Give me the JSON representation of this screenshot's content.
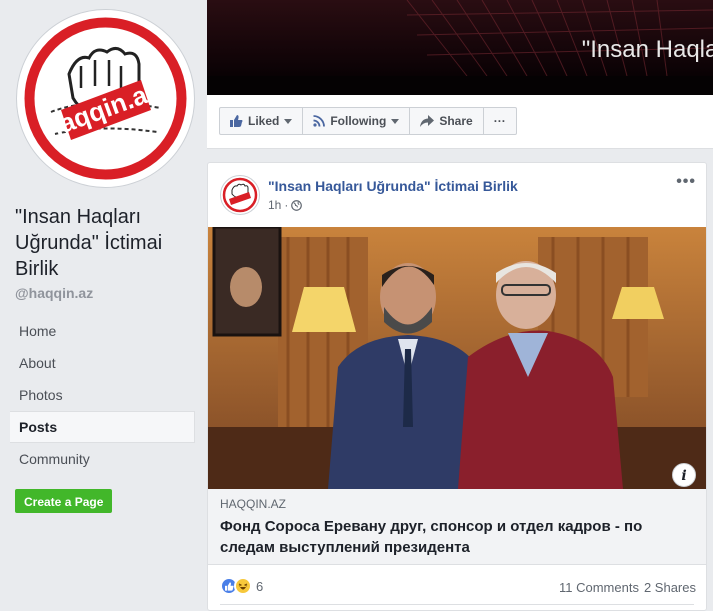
{
  "page": {
    "name": "\"Insan Haqları Uğrunda\" İctimai Birlik",
    "handle": "@haqqin.az",
    "logo_text": "haqqin.az"
  },
  "nav": {
    "items": [
      {
        "label": "Home",
        "active": false
      },
      {
        "label": "About",
        "active": false
      },
      {
        "label": "Photos",
        "active": false
      },
      {
        "label": "Posts",
        "active": true
      },
      {
        "label": "Community",
        "active": false
      }
    ],
    "create_page": "Create a Page"
  },
  "cover": {
    "title": "\"Insan Haqları"
  },
  "actions": {
    "liked": "Liked",
    "following": "Following",
    "share": "Share",
    "more": "···"
  },
  "post": {
    "author": "\"Insan Haqları Uğrunda\" İctimai Birlik",
    "time": "1h",
    "more": "•••",
    "link": {
      "domain": "HAQQIN.AZ",
      "title": "Фонд Сороса Еревану друг, спонсор и отдел кадров - по следам выступлений президента"
    },
    "reactions": {
      "count": "6",
      "types": [
        "like-icon",
        "haha-icon"
      ]
    },
    "comments": "11 Comments",
    "shares": "2 Shares",
    "info_label": "i"
  },
  "colors": {
    "link_blue": "#365899",
    "green_button": "#42b72a",
    "background": "#e9ebee"
  }
}
